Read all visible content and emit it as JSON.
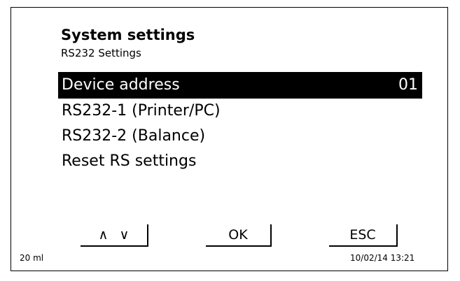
{
  "header": {
    "title": "System settings",
    "subtitle": "RS232 Settings"
  },
  "menu": {
    "items": [
      {
        "label": "Device address",
        "value": "01",
        "selected": true
      },
      {
        "label": "RS232-1 (Printer/PC)"
      },
      {
        "label": "RS232-2 (Balance)"
      },
      {
        "label": "Reset RS settings"
      }
    ]
  },
  "softkeys": {
    "up_glyph": "∧",
    "down_glyph": "∨",
    "ok_label": "OK",
    "esc_label": "ESC"
  },
  "status": {
    "volume": "20 ml",
    "datetime": "10/02/14 13:21"
  }
}
